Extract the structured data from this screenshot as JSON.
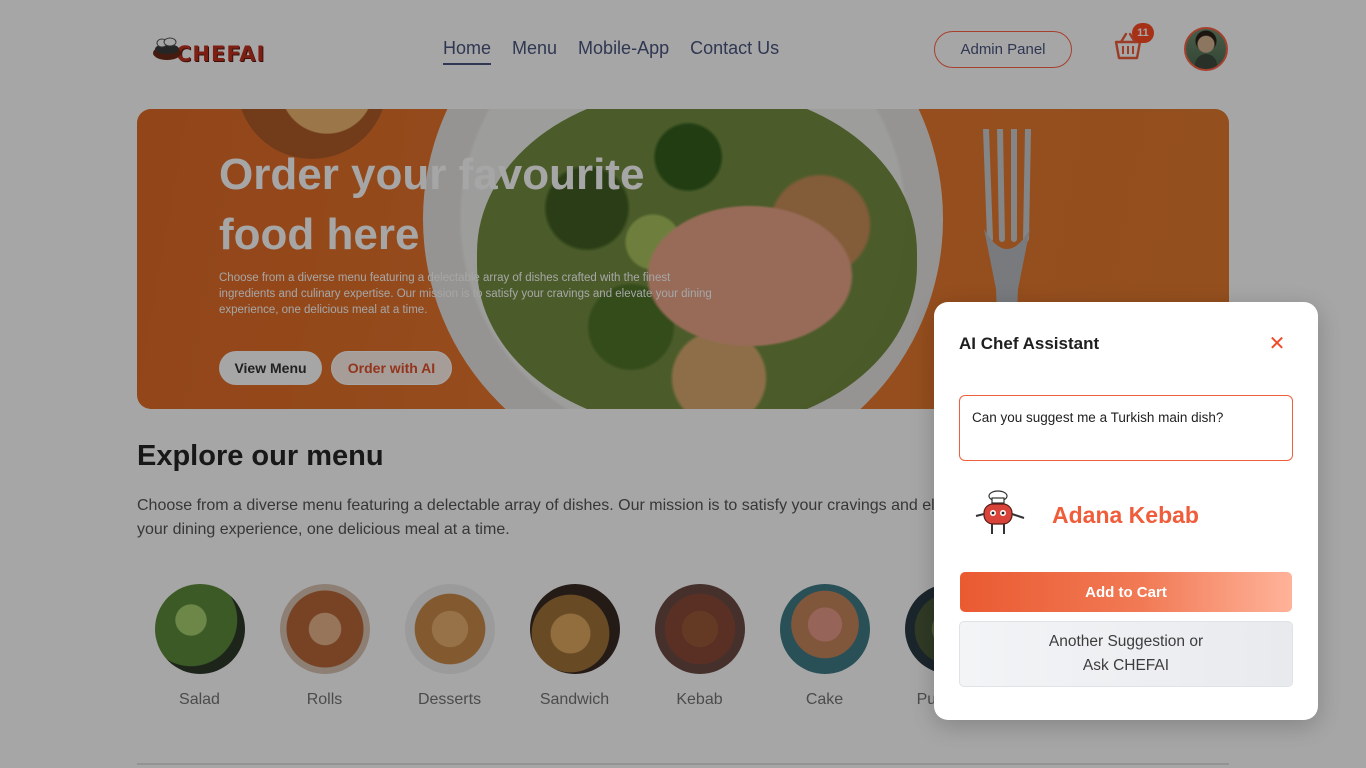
{
  "navbar": {
    "logo_text": "CHEFAI",
    "links": [
      {
        "label": "Home",
        "active": true
      },
      {
        "label": "Menu",
        "active": false
      },
      {
        "label": "Mobile-App",
        "active": false
      },
      {
        "label": "Contact Us",
        "active": false
      }
    ],
    "admin_label": "Admin Panel",
    "cart_count": "11",
    "icons": {
      "basket": "basket-icon",
      "avatar": "user-avatar"
    }
  },
  "hero": {
    "title": "Order your favourite food here",
    "description": "Choose from a diverse menu featuring a delectable array of dishes crafted with the finest ingredients and culinary expertise. Our mission is to satisfy your cravings and elevate your dining experience, one delicious meal at a time.",
    "view_menu_label": "View Menu",
    "order_ai_label": "Order with AI"
  },
  "explore": {
    "title": "Explore our menu",
    "description": "Choose from a diverse menu featuring a delectable array of dishes. Our mission is to satisfy your cravings and elevate your dining experience, one delicious meal at a time.",
    "items": [
      {
        "label": "Salad",
        "color": "#5c8a3a"
      },
      {
        "label": "Rolls",
        "color": "#b8683a"
      },
      {
        "label": "Desserts",
        "color": "#c98a4a"
      },
      {
        "label": "Sandwich",
        "color": "#a0743a"
      },
      {
        "label": "Kebab",
        "color": "#8a4a3a"
      },
      {
        "label": "Cake",
        "color": "#c6865c"
      },
      {
        "label": "Pure Veg",
        "color": "#4a5a3a"
      }
    ]
  },
  "popup": {
    "title": "AI Chef Assistant",
    "close_icon": "close-icon",
    "input_value": "Can you suggest me a Turkish main dish?",
    "suggestion": "Adana Kebab",
    "add_to_cart_label": "Add to Cart",
    "another_label": "Another Suggestion or\nAsk CHEFAI"
  },
  "colors": {
    "accent": "#ef5d3b",
    "text": "#49557e",
    "hero_bg": "#e06a26"
  }
}
